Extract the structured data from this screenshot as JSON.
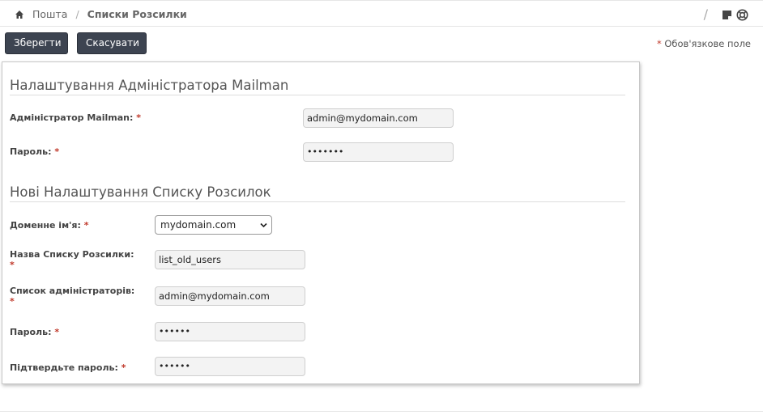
{
  "breadcrumb": {
    "home": "Пошта",
    "separator": "/",
    "current": "Списки Розсилки"
  },
  "toolbar": {
    "separator": "/",
    "icons": [
      "note-icon",
      "help-icon"
    ]
  },
  "buttons": {
    "save": "Зберегти",
    "cancel": "Скасувати"
  },
  "required_note": {
    "star": "*",
    "text": "Обов'язкове поле"
  },
  "admin_section": {
    "title": "Налаштування Адміністратора Mailman",
    "admin_label": "Адміністратор Mailman:",
    "admin_value": "admin@mydomain.com",
    "password_label": "Пароль:",
    "password_value": "•••••••"
  },
  "list_section": {
    "title": "Нові Налаштування Списку Розсилок",
    "domain_label": "Доменне ім'я:",
    "domain_value": "mydomain.com",
    "list_name_label": "Назва Списку Розсилки:",
    "list_name_value": "list_old_users",
    "admins_label": "Список адміністраторів:",
    "admins_value": "admin@mydomain.com",
    "password_label": "Пароль:",
    "password_value": "••••••",
    "confirm_label": "Підтвердьте пароль:",
    "confirm_value": "••••••"
  },
  "req": "*",
  "colors": {
    "button": "#3d4451",
    "required": "#c0392b"
  }
}
